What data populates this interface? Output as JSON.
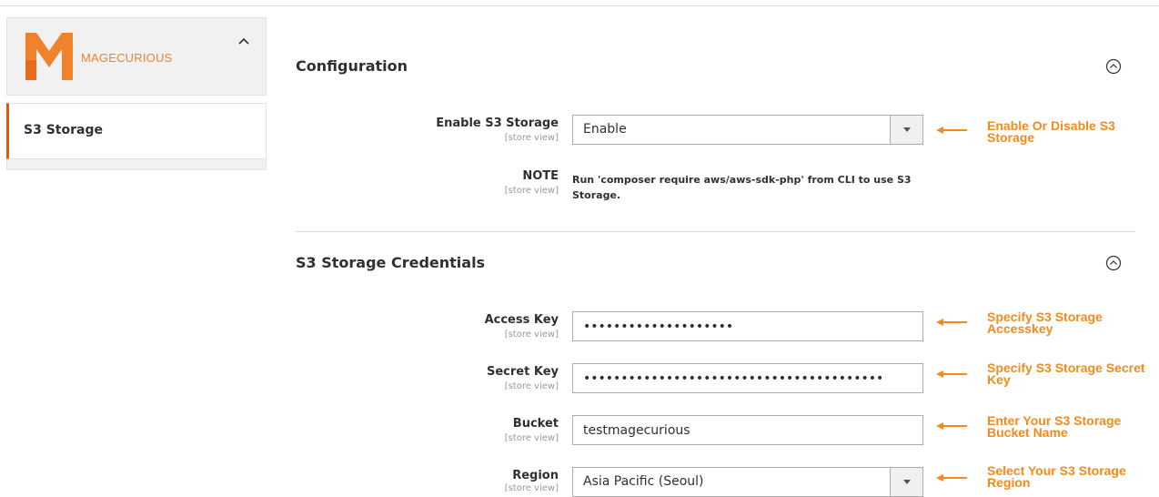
{
  "brand": {
    "logo_text": "MAGECURIOUS",
    "accent_color": "#eb5202",
    "logo_color": "#f0822c",
    "annotation_color": "#f28a1c"
  },
  "sidebar": {
    "collapse_icon": "chevron-up-icon",
    "items": [
      {
        "label": "S3 Storage",
        "active": true
      }
    ]
  },
  "sections": {
    "configuration": {
      "title": "Configuration",
      "toggle_icon": "circle-chevron-up-icon",
      "fields": {
        "enable": {
          "label": "Enable S3 Storage",
          "scope": "[store view]",
          "value": "Enable",
          "annotation": "Enable Or Disable S3 Storage"
        },
        "note": {
          "label": "NOTE",
          "scope": "[store view]",
          "text": "Run 'composer require aws/aws-sdk-php' from CLI to use S3 Storage."
        }
      }
    },
    "credentials": {
      "title": "S3 Storage Credentials",
      "toggle_icon": "circle-chevron-up-icon",
      "fields": {
        "access_key": {
          "label": "Access Key",
          "scope": "[store view]",
          "value": "••••••••••••••••••••",
          "annotation": "Specify S3 Storage Accesskey"
        },
        "secret_key": {
          "label": "Secret Key",
          "scope": "[store view]",
          "value": "••••••••••••••••••••••••••••••••••••••••",
          "annotation": "Specify S3 Storage Secret Key"
        },
        "bucket": {
          "label": "Bucket",
          "scope": "[store view]",
          "value": "testmagecurious",
          "annotation": "Enter Your S3 Storage Bucket Name"
        },
        "region": {
          "label": "Region",
          "scope": "[store view]",
          "value": "Asia Pacific (Seoul)",
          "annotation": "Select Your S3 Storage Region"
        }
      }
    }
  }
}
